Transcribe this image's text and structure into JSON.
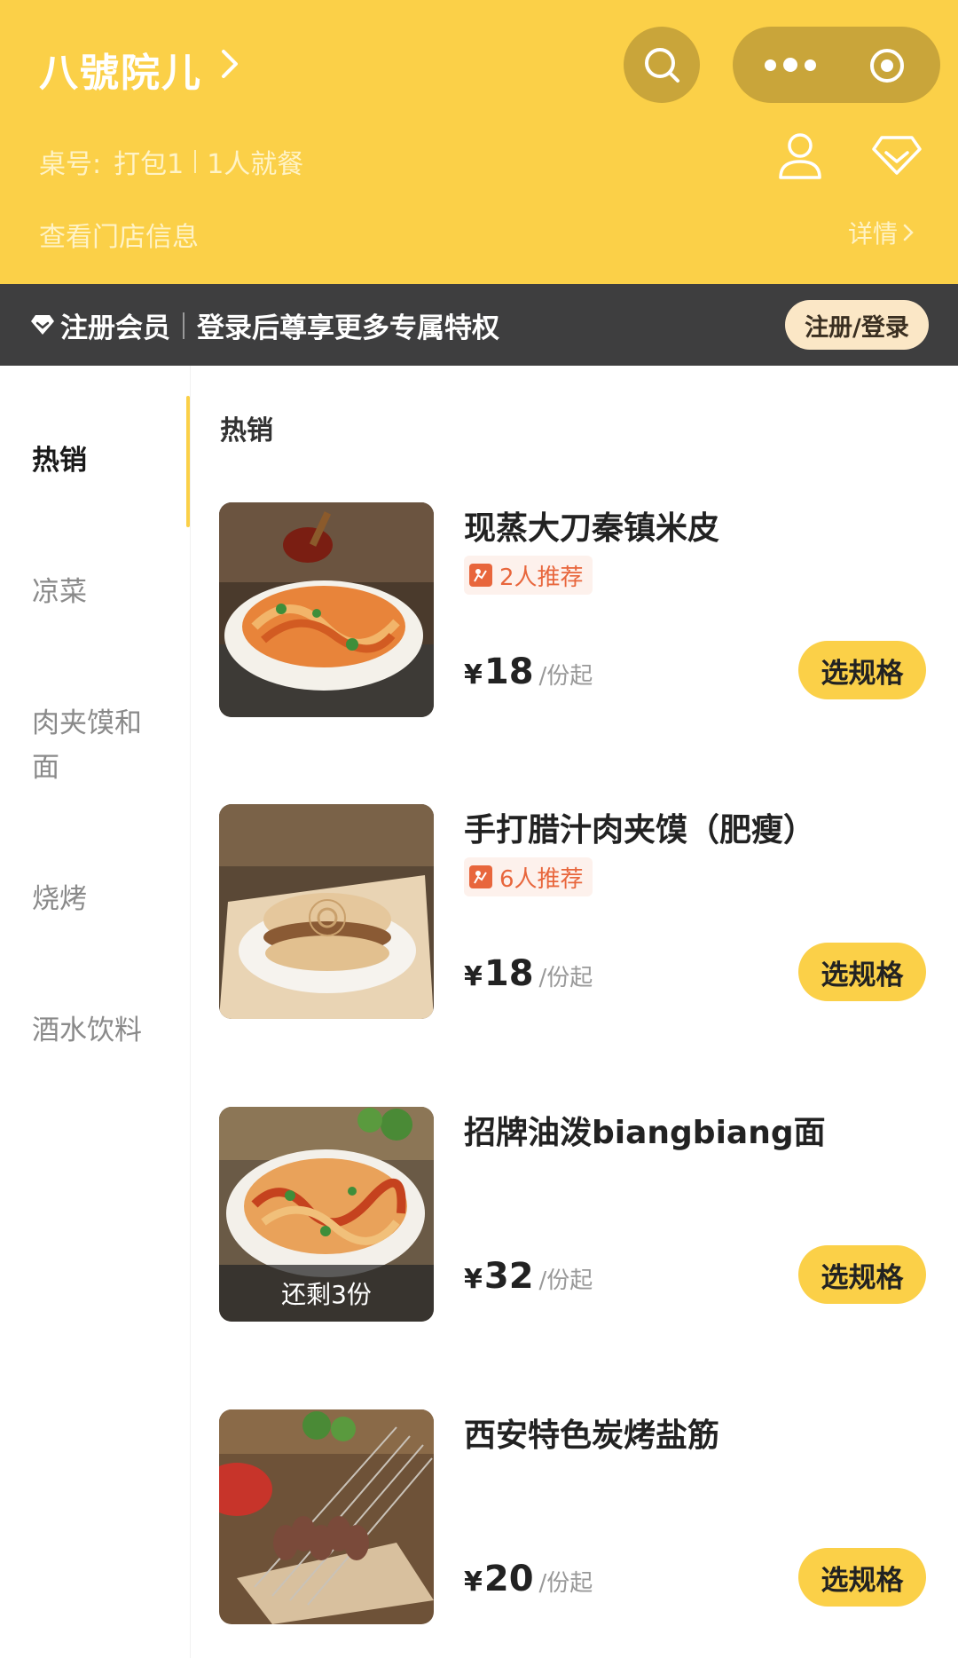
{
  "header": {
    "store_name": "八號院儿",
    "table_label": "桌号:",
    "table_value": "打包1",
    "diners": "1人就餐",
    "store_info_link": "查看门店信息",
    "detail_link": "详情"
  },
  "member_bar": {
    "title": "注册会员",
    "subtitle": "登录后尊享更多专属特权",
    "login_button": "注册/登录"
  },
  "categories": [
    {
      "label": "热销",
      "active": true
    },
    {
      "label": "凉菜",
      "active": false
    },
    {
      "label": "肉夹馍和面",
      "active": false
    },
    {
      "label": "烧烤",
      "active": false
    },
    {
      "label": "酒水饮料",
      "active": false
    }
  ],
  "section_title": "热销",
  "products": [
    {
      "name": "现蒸大刀秦镇米皮",
      "recommend": "2人推荐",
      "currency": "¥",
      "price": "18",
      "unit": "/份起",
      "button": "选规格",
      "remaining": ""
    },
    {
      "name": "手打腊汁肉夹馍（肥瘦）",
      "recommend": "6人推荐",
      "currency": "¥",
      "price": "18",
      "unit": "/份起",
      "button": "选规格",
      "remaining": ""
    },
    {
      "name": "招牌油泼biangbiang面",
      "recommend": "",
      "currency": "¥",
      "price": "32",
      "unit": "/份起",
      "button": "选规格",
      "remaining": "还剩3份"
    },
    {
      "name": "西安特色炭烤盐筋",
      "recommend": "",
      "currency": "¥",
      "price": "20",
      "unit": "/份起",
      "button": "选规格",
      "remaining": ""
    }
  ],
  "colors": {
    "brand_yellow": "#fbd048",
    "member_bar_bg": "#3e3e3f",
    "recommend_orange": "#e8663c"
  }
}
